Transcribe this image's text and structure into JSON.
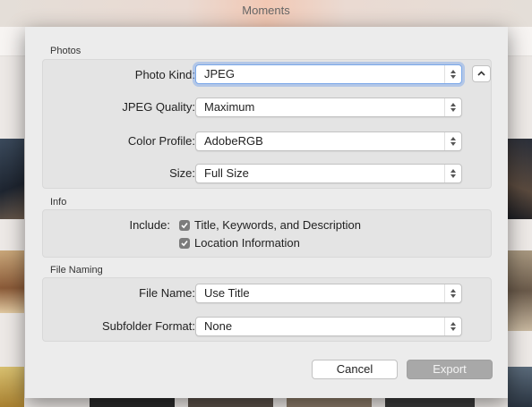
{
  "window": {
    "title": "Moments"
  },
  "dialog": {
    "photos_section": {
      "header": "Photos",
      "photo_kind": {
        "label": "Photo Kind:",
        "value": "JPEG"
      },
      "jpeg_quality": {
        "label": "JPEG Quality:",
        "value": "Maximum"
      },
      "color_profile": {
        "label": "Color Profile:",
        "value": "AdobeRGB"
      },
      "size": {
        "label": "Size:",
        "value": "Full Size"
      }
    },
    "info_section": {
      "header": "Info",
      "include_label": "Include:",
      "options": [
        {
          "label": "Title, Keywords, and Description",
          "checked": true
        },
        {
          "label": "Location Information",
          "checked": true
        }
      ]
    },
    "file_naming_section": {
      "header": "File Naming",
      "file_name": {
        "label": "File Name:",
        "value": "Use Title"
      },
      "subfolder_format": {
        "label": "Subfolder Format:",
        "value": "None"
      }
    },
    "buttons": {
      "cancel": "Cancel",
      "export": "Export"
    }
  },
  "colors": {
    "focus_ring": "#7aa7e8",
    "checkbox": "#7c7c7c",
    "export_disabled": "#a8a8a8"
  }
}
